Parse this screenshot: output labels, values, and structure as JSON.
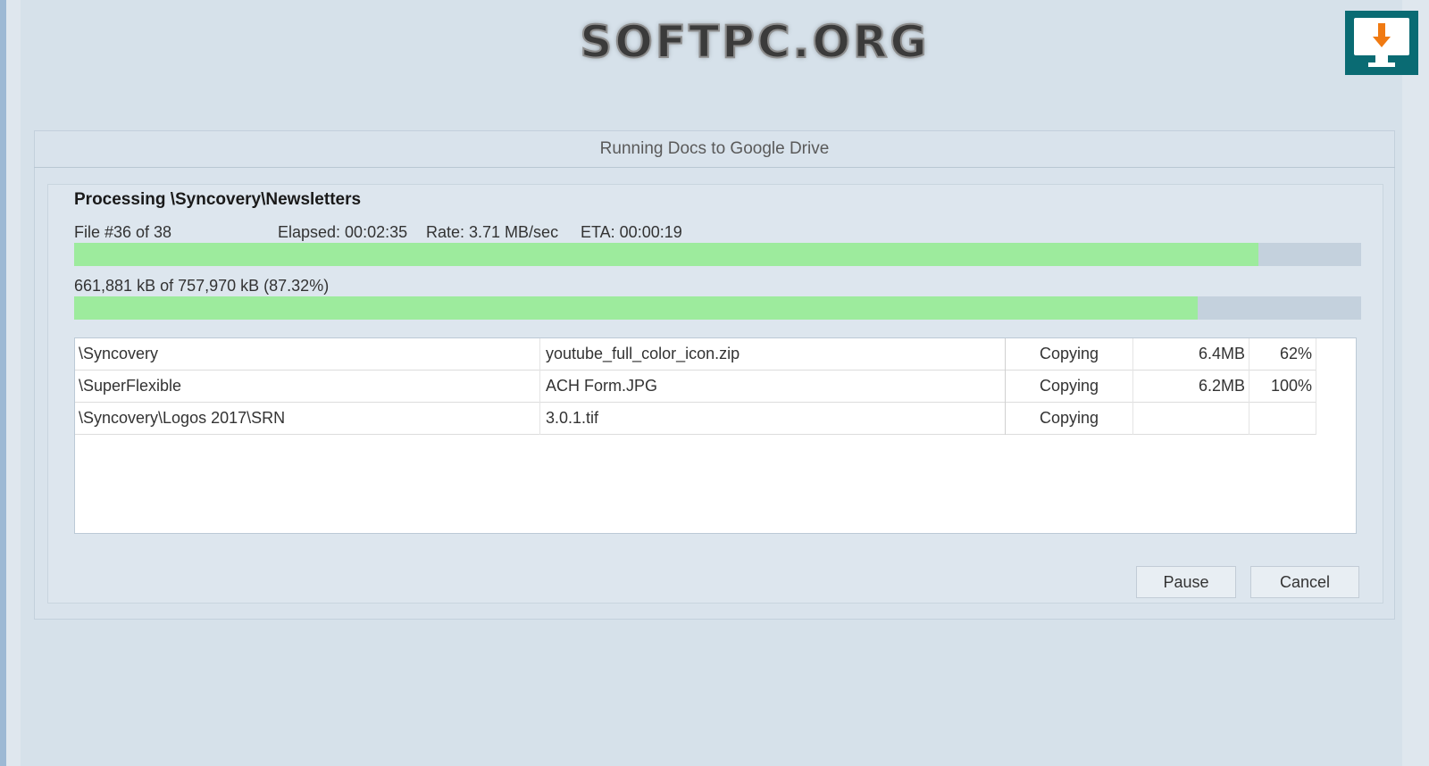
{
  "watermark": {
    "text": "SOFTPC.ORG",
    "icon": "monitor-download-icon",
    "icon_color": "#0a6b73",
    "arrow_color": "#f07a12"
  },
  "dialog": {
    "title": "Running Docs to Google Drive",
    "processing": "Processing \\Syncovery\\Newsletters",
    "file_counter": "File #36 of 38",
    "elapsed": "Elapsed: 00:02:35",
    "rate": "Rate: 3.71 MB/sec",
    "eta": "ETA: 00:00:19",
    "bytes": "661,881 kB of 757,970 kB (87.32%)"
  },
  "progress": {
    "file_fraction": 0.92,
    "bytes_fraction": 0.8732,
    "fill_color": "#9deb9d",
    "track_color": "#c4d1dd"
  },
  "files": [
    {
      "path": "\\Syncovery",
      "file": "youtube_full_color_icon.zip",
      "status": "Copying",
      "size": "6.4MB",
      "percent": "62%"
    },
    {
      "path": "\\SuperFlexible",
      "file": "ACH Form.JPG",
      "status": "Copying",
      "size": "6.2MB",
      "percent": "100%"
    },
    {
      "path": "\\Syncovery\\Logos 2017\\SRN",
      "file": "3.0.1.tif",
      "status": "Copying",
      "size": "",
      "percent": ""
    }
  ],
  "buttons": {
    "pause": "Pause",
    "cancel": "Cancel"
  }
}
